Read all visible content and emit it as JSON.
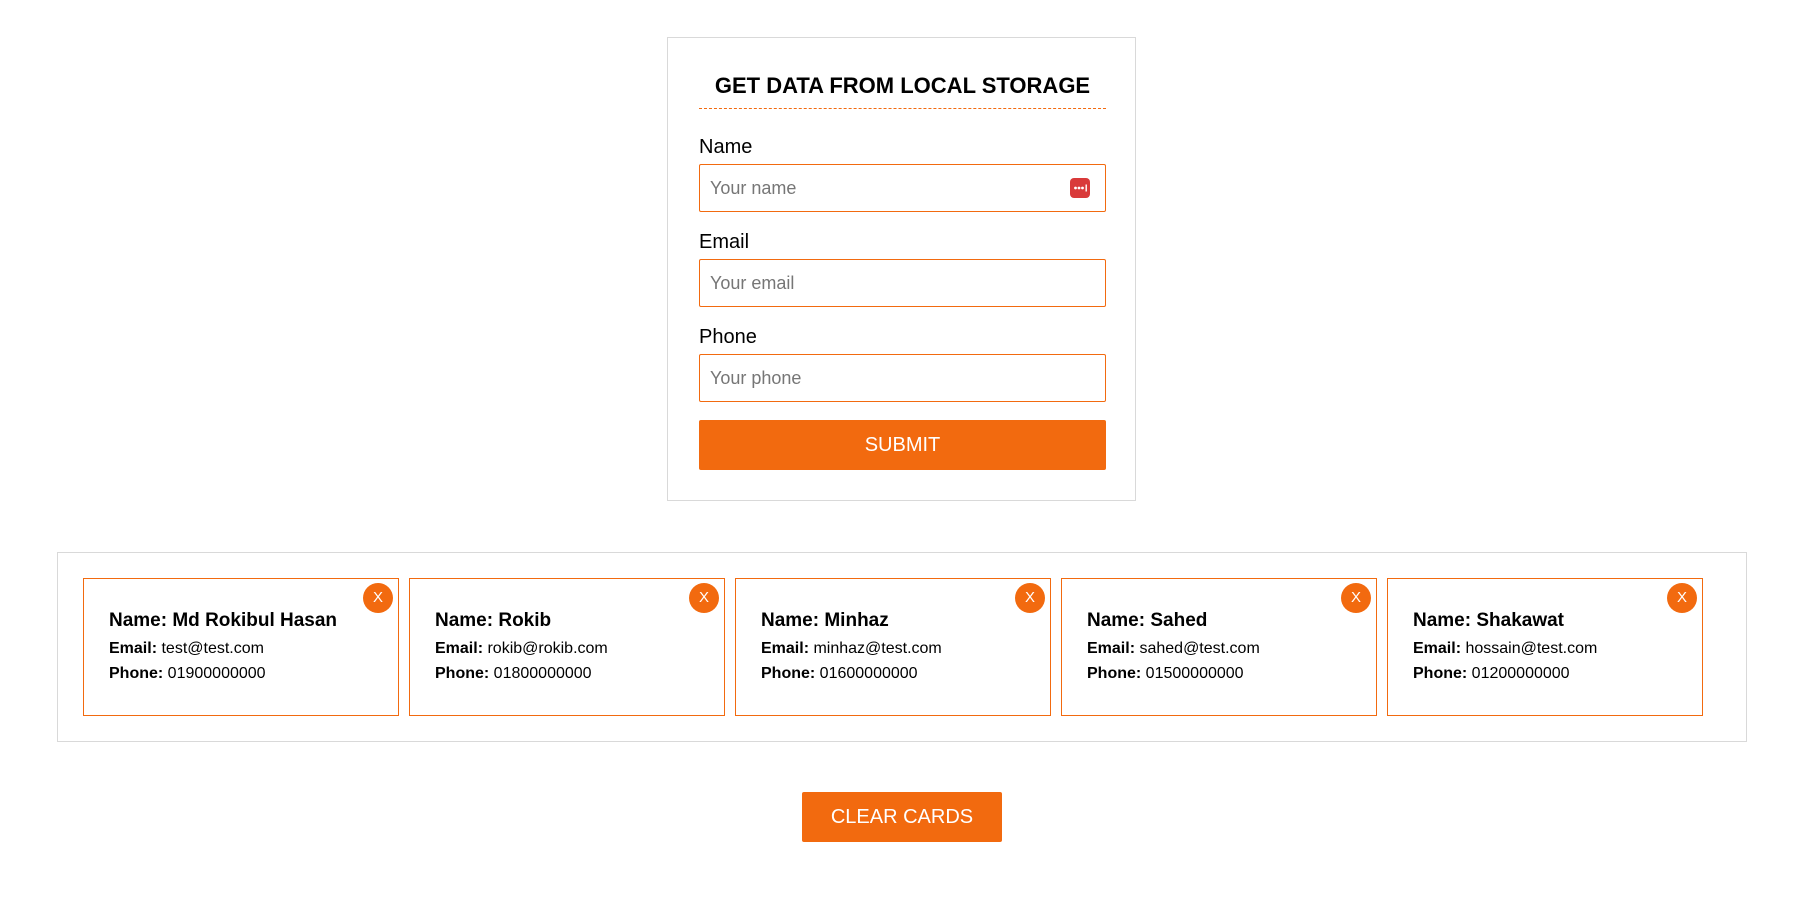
{
  "form": {
    "title": "GET DATA FROM LOCAL STORAGE",
    "name_label": "Name",
    "name_placeholder": "Your name",
    "email_label": "Email",
    "email_placeholder": "Your email",
    "phone_label": "Phone",
    "phone_placeholder": "Your phone",
    "submit_label": "SUBMIT",
    "password_manager_icon": "password-manager-icon"
  },
  "cards": [
    {
      "name": "Name: Md Rokibul Hasan",
      "email_label": "Email:",
      "email": "test@test.com",
      "phone_label": "Phone:",
      "phone": "01900000000",
      "close_label": "X"
    },
    {
      "name": "Name: Rokib",
      "email_label": "Email:",
      "email": "rokib@rokib.com",
      "phone_label": "Phone:",
      "phone": "01800000000",
      "close_label": "X"
    },
    {
      "name": "Name: Minhaz",
      "email_label": "Email:",
      "email": "minhaz@test.com",
      "phone_label": "Phone:",
      "phone": "01600000000",
      "close_label": "X"
    },
    {
      "name": "Name: Sahed",
      "email_label": "Email:",
      "email": "sahed@test.com",
      "phone_label": "Phone:",
      "phone": "01500000000",
      "close_label": "X"
    },
    {
      "name": "Name: Shakawat",
      "email_label": "Email:",
      "email": "hossain@test.com",
      "phone_label": "Phone:",
      "phone": "01200000000",
      "close_label": "X"
    }
  ],
  "clear_label": "CLEAR CARDS",
  "colors": {
    "accent": "#f26a0f",
    "border": "#d9d9d9",
    "password_icon": "#d93a3a"
  }
}
